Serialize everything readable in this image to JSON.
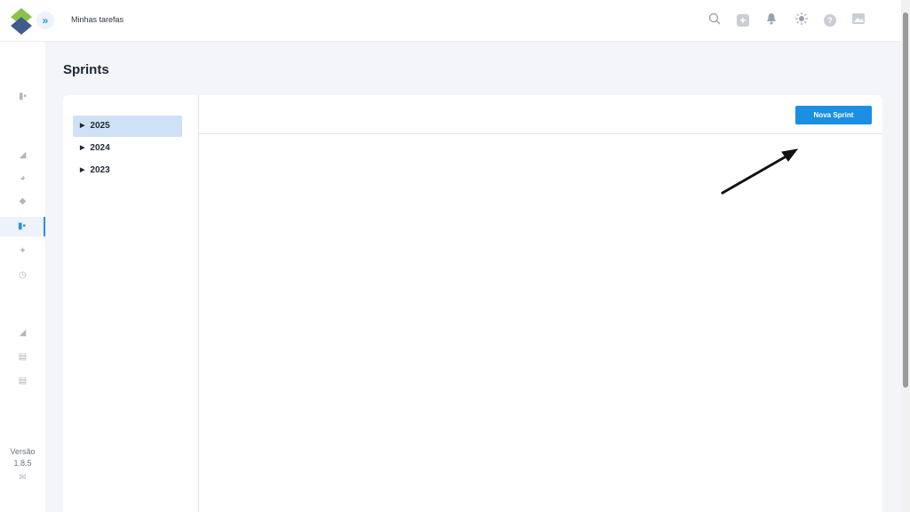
{
  "header": {
    "breadcrumb": "Minhas tarefas",
    "expand_glyph": "»",
    "icons": [
      "search-icon",
      "add-icon",
      "notification-bell-icon",
      "theme-sun-icon",
      "help-icon",
      "image-icon"
    ],
    "help_glyph": "?",
    "plus_glyph": "+"
  },
  "sidebar": {
    "icons": [
      "board-icon",
      "chart-icon",
      "pie-chart-icon",
      "layers-icon",
      "sprint-board-icon",
      "pin-icon",
      "clock-icon",
      "chart-icon",
      "document-icon",
      "document-icon",
      "mail-icon"
    ],
    "active": "sprint-board-icon",
    "version_label": "Versão",
    "version_number": "1.8.5"
  },
  "page": {
    "title": "Sprints"
  },
  "tree": {
    "items": [
      {
        "label": "2025",
        "selected": true
      },
      {
        "label": "2024",
        "selected": false
      },
      {
        "label": "2023",
        "selected": false
      }
    ]
  },
  "toolbar": {
    "new_sprint_label": "Nova Sprint"
  },
  "colors": {
    "accent": "#1a8fe3",
    "selection": "#cfe2f5",
    "background": "#f3f5f8"
  }
}
